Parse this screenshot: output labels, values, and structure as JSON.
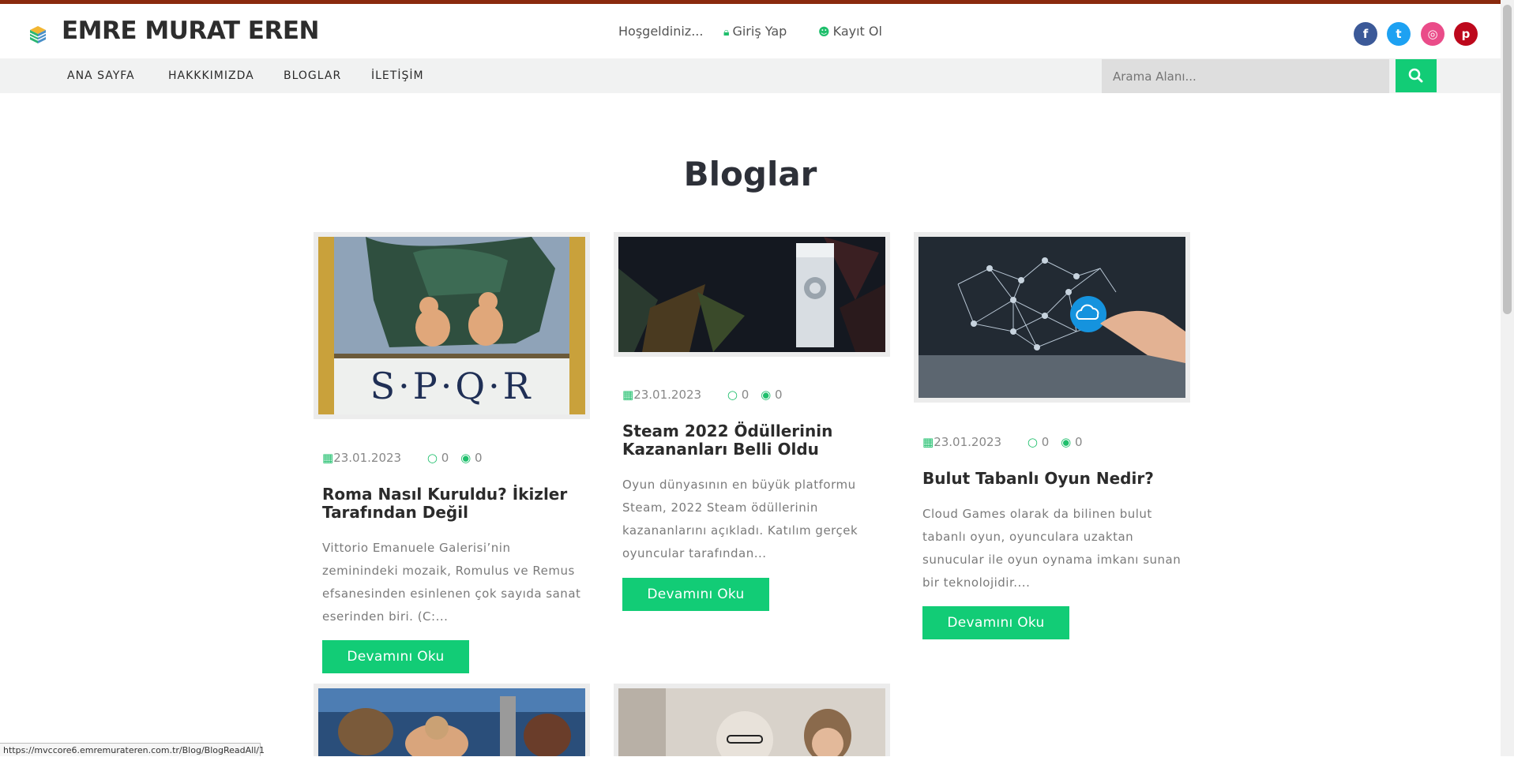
{
  "header": {
    "brand": "EMRE MURAT EREN",
    "welcome": "Hoşgeldiniz...",
    "login": "Giriş Yap",
    "register": "Kayıt Ol",
    "social": [
      {
        "name": "facebook-icon",
        "glyph": "f",
        "color": "#3b5998"
      },
      {
        "name": "twitter-icon",
        "glyph": "t",
        "color": "#1da1f2"
      },
      {
        "name": "dribbble-icon",
        "glyph": "◎",
        "color": "#ea4c89"
      },
      {
        "name": "pinterest-icon",
        "glyph": "p",
        "color": "#bd081c"
      }
    ]
  },
  "nav": {
    "items": [
      "ANA SAYFA",
      "HAKKKIMIZDA",
      "BLOGLAR",
      "İLETİŞİM"
    ],
    "search_placeholder": "Arama Alanı..."
  },
  "page": {
    "title": "Bloglar"
  },
  "posts": [
    {
      "date": "23.01.2023",
      "comments": "0",
      "views": "0",
      "title": "Roma Nasıl Kuruldu? İkizler Tarafından Değil",
      "desc": "Vittorio Emanuele Galerisi’nin zeminindeki mozaik, Romulus ve Remus efsanesinden esinlenen çok sayıda sanat eserinden biri. (C:...",
      "button": "Devamını Oku",
      "image_text": "S·P·Q·R"
    },
    {
      "date": "23.01.2023",
      "comments": "0",
      "views": "0",
      "title": "Steam 2022 Ödüllerinin Kazananları Belli Oldu",
      "desc": "Oyun dünyasının en büyük platformu Steam, 2022 Steam ödüllerinin kazananlarını açıkladı. Katılım gerçek oyuncular tarafından...",
      "button": "Devamını Oku"
    },
    {
      "date": "23.01.2023",
      "comments": "0",
      "views": "0",
      "title": "Bulut Tabanlı Oyun Nedir?",
      "desc": "Cloud Games olarak da bilinen bulut tabanlı oyun, oyunculara uzaktan sunucular ile oyun oynama imkanı sunan bir teknolojidir....",
      "button": "Devamını Oku"
    }
  ],
  "status_url": "https://mvccore6.emremurateren.com.tr/Blog/BlogReadAll/1"
}
